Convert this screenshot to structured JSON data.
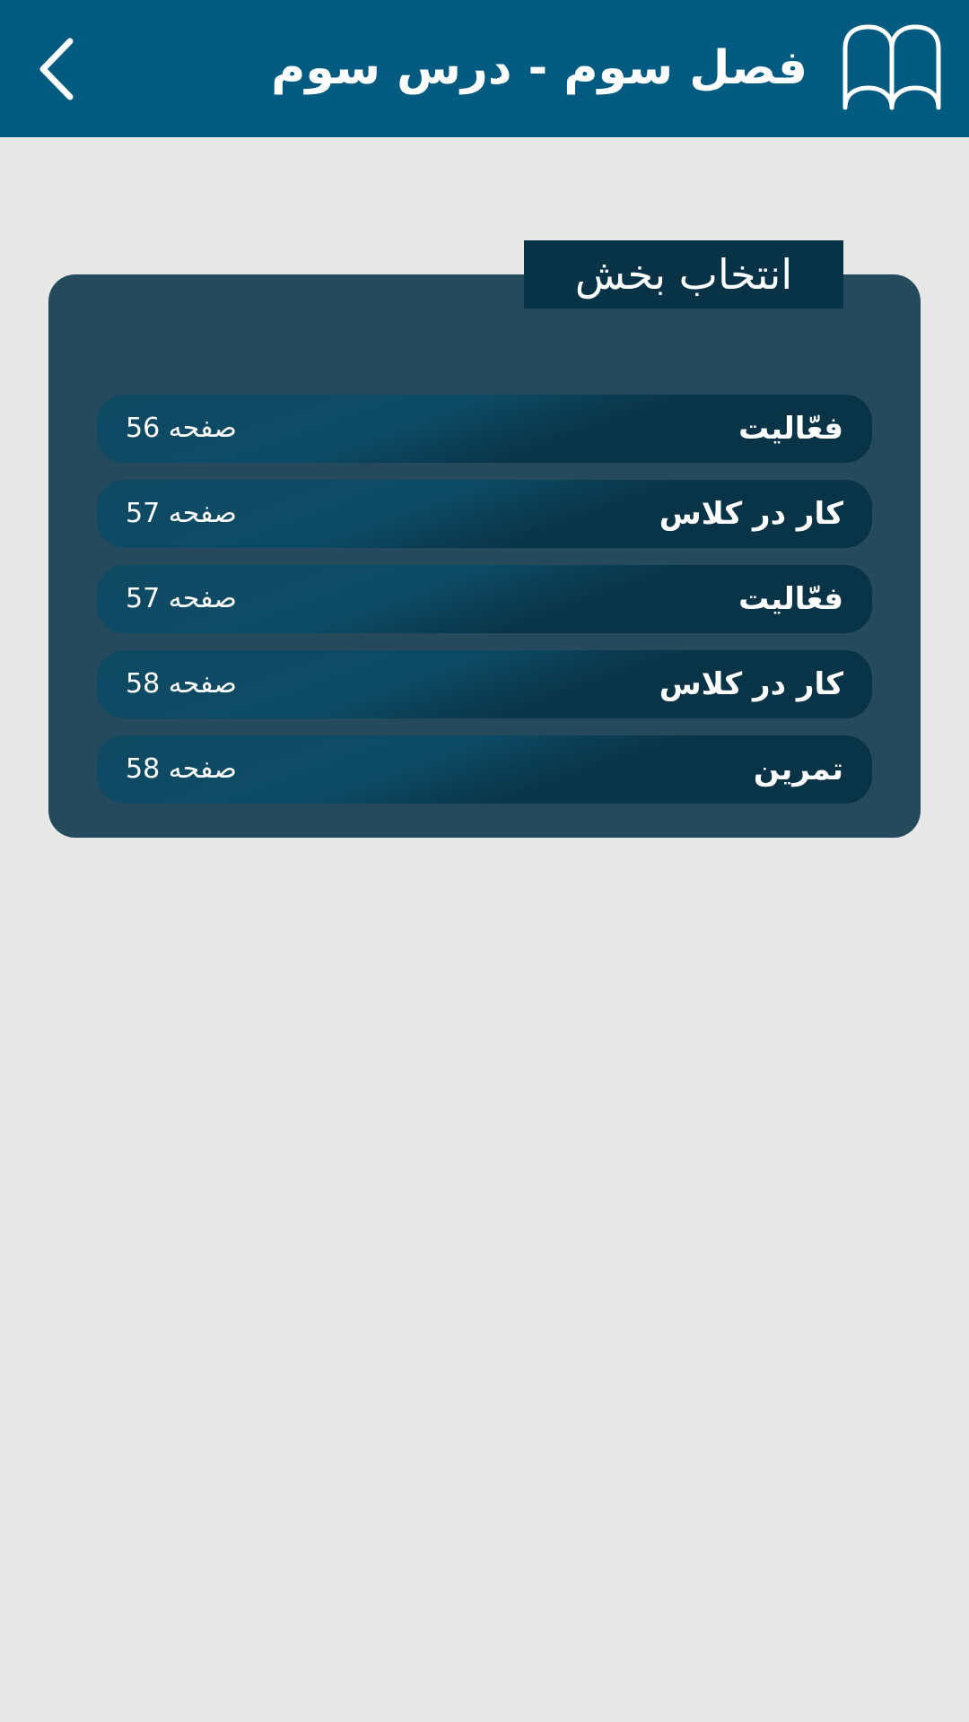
{
  "header": {
    "title": "فصل سوم - درس سوم",
    "back_icon": "chevron-left-icon",
    "book_icon": "book-icon",
    "background_color": "#015b80"
  },
  "panel": {
    "heading": "انتخاب بخش",
    "items": [
      {
        "label": "فعّالیت",
        "page": "صفحه 56"
      },
      {
        "label": "کار در کلاس",
        "page": "صفحه 57"
      },
      {
        "label": "فعّالیت",
        "page": "صفحه 57"
      },
      {
        "label": "کار در کلاس",
        "page": "صفحه 58"
      },
      {
        "label": "تمرین",
        "page": "صفحه 58"
      }
    ]
  },
  "colors": {
    "page_background": "#e7e7e8",
    "panel_background": "#244a5c",
    "tab_background": "#083347",
    "row_dark": "#093447",
    "row_light": "#0d4b65",
    "text": "#ffffff"
  }
}
